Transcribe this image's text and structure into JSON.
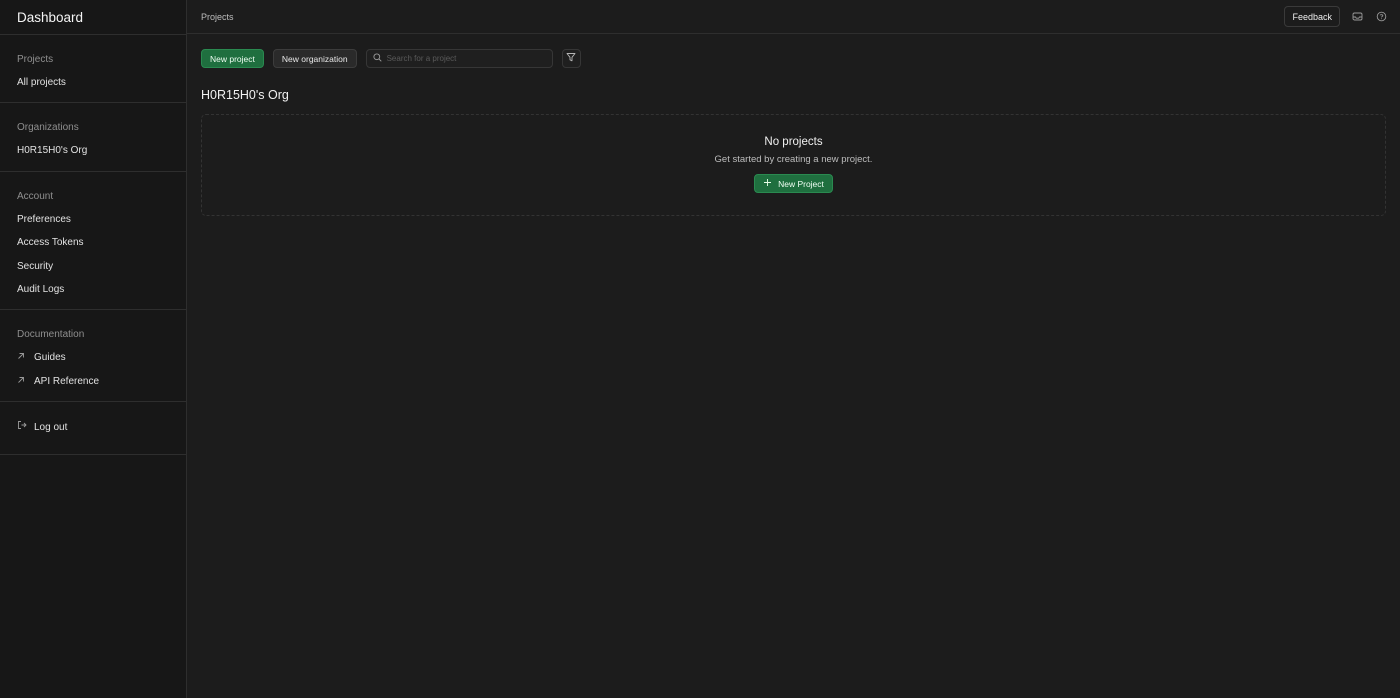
{
  "sidebar": {
    "title": "Dashboard",
    "sections": {
      "projects": {
        "heading": "Projects",
        "items": [
          "All projects"
        ]
      },
      "organizations": {
        "heading": "Organizations",
        "items": [
          "H0R15H0's Org"
        ]
      },
      "account": {
        "heading": "Account",
        "items": [
          "Preferences",
          "Access Tokens",
          "Security",
          "Audit Logs"
        ]
      },
      "documentation": {
        "heading": "Documentation",
        "items": [
          "Guides",
          "API Reference"
        ]
      }
    },
    "logout_label": "Log out"
  },
  "topbar": {
    "breadcrumb": "Projects",
    "feedback_label": "Feedback",
    "icons": [
      "inbox-icon",
      "help-icon"
    ]
  },
  "toolbar": {
    "new_project_label": "New project",
    "new_org_label": "New organization",
    "search_placeholder": "Search for a project",
    "filter_icon": "filter-icon"
  },
  "org": {
    "name": "H0R15H0's Org",
    "empty_title": "No projects",
    "empty_subtitle": "Get started by creating a new project.",
    "empty_button_label": "New Project"
  },
  "colors": {
    "background": "#1c1c1c",
    "sidebar_bg": "#171717",
    "accent_green": "#1f6f3f",
    "border": "#2e2e2e"
  }
}
